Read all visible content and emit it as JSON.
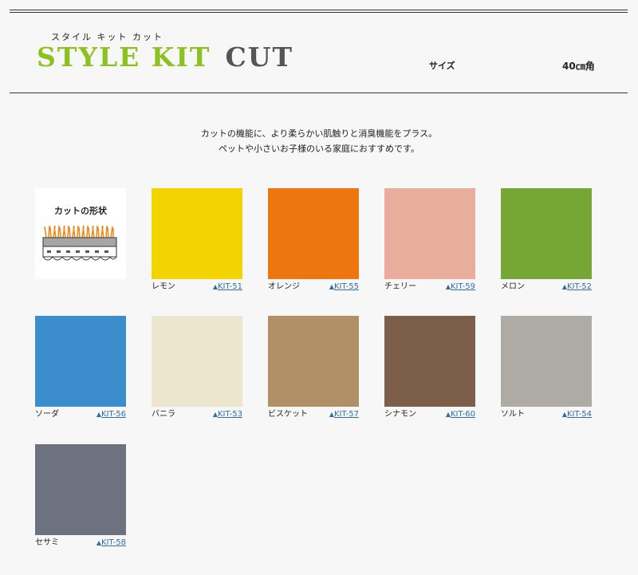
{
  "header": {
    "subtitle_kana": "スタイル キット カット",
    "logo_part1": "STYLE KIT",
    "logo_part2": "CUT",
    "size_label": "サイズ",
    "size_value": "40㎝角"
  },
  "description": {
    "line1": "カットの機能に、より柔らかい肌触りと消臭機能をプラス。",
    "line2": "ペットや小さいお子様のいる家庭におすすめです。"
  },
  "shape_card": {
    "title": "カットの形状"
  },
  "colors": [
    {
      "name": "レモン",
      "code": "KIT-51",
      "color": "#f2d500"
    },
    {
      "name": "オレンジ",
      "code": "KIT-55",
      "color": "#ee7611"
    },
    {
      "name": "チェリー",
      "code": "KIT-59",
      "color": "#e9ad9b"
    },
    {
      "name": "メロン",
      "code": "KIT-52",
      "color": "#76a736"
    },
    {
      "name": "ソーダ",
      "code": "KIT-56",
      "color": "#3b8ecb"
    },
    {
      "name": "バニラ",
      "code": "KIT-53",
      "color": "#ede6cf"
    },
    {
      "name": "ビスケット",
      "code": "KIT-57",
      "color": "#b29067"
    },
    {
      "name": "シナモン",
      "code": "KIT-60",
      "color": "#7d5e4a"
    },
    {
      "name": "ソルト",
      "code": "KIT-54",
      "color": "#aeaba4"
    },
    {
      "name": "セサミ",
      "code": "KIT-58",
      "color": "#6c7280"
    }
  ],
  "link_marker": "▲"
}
